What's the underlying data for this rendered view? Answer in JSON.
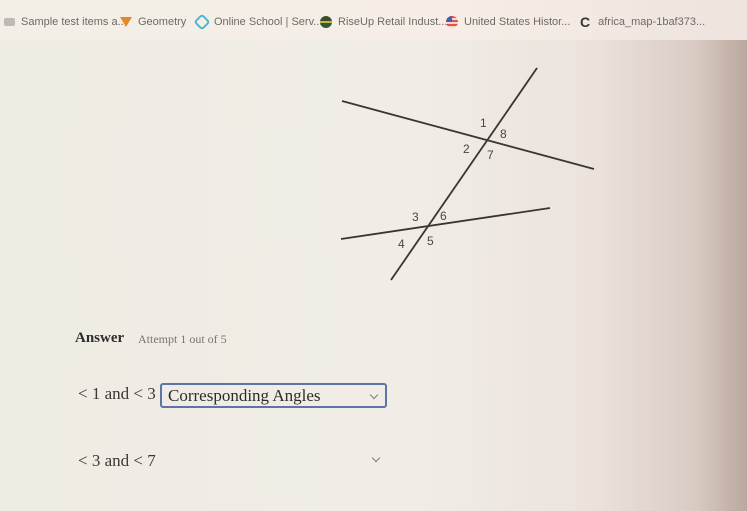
{
  "bookmarks": [
    {
      "label": "Sample test items a...",
      "icon": "document-icon"
    },
    {
      "label": "Geometry",
      "icon": "geometry-icon"
    },
    {
      "label": "Online School | Serv...",
      "icon": "diamond-icon"
    },
    {
      "label": "RiseUp Retail Indust...",
      "icon": "riseup-icon"
    },
    {
      "label": "United States Histor...",
      "icon": "us-flag-icon"
    },
    {
      "label": "africa_map-1baf373...",
      "icon": "c-icon"
    }
  ],
  "diagram": {
    "angle_labels": [
      "1",
      "2",
      "7",
      "8",
      "3",
      "4",
      "5",
      "6"
    ]
  },
  "answer": {
    "label": "Answer",
    "attempt": "Attempt 1 out of 5"
  },
  "questions": [
    {
      "prompt": "< 1 and < 3",
      "selected": "Corresponding Angles"
    },
    {
      "prompt": "< 3 and < 7",
      "selected": ""
    }
  ]
}
